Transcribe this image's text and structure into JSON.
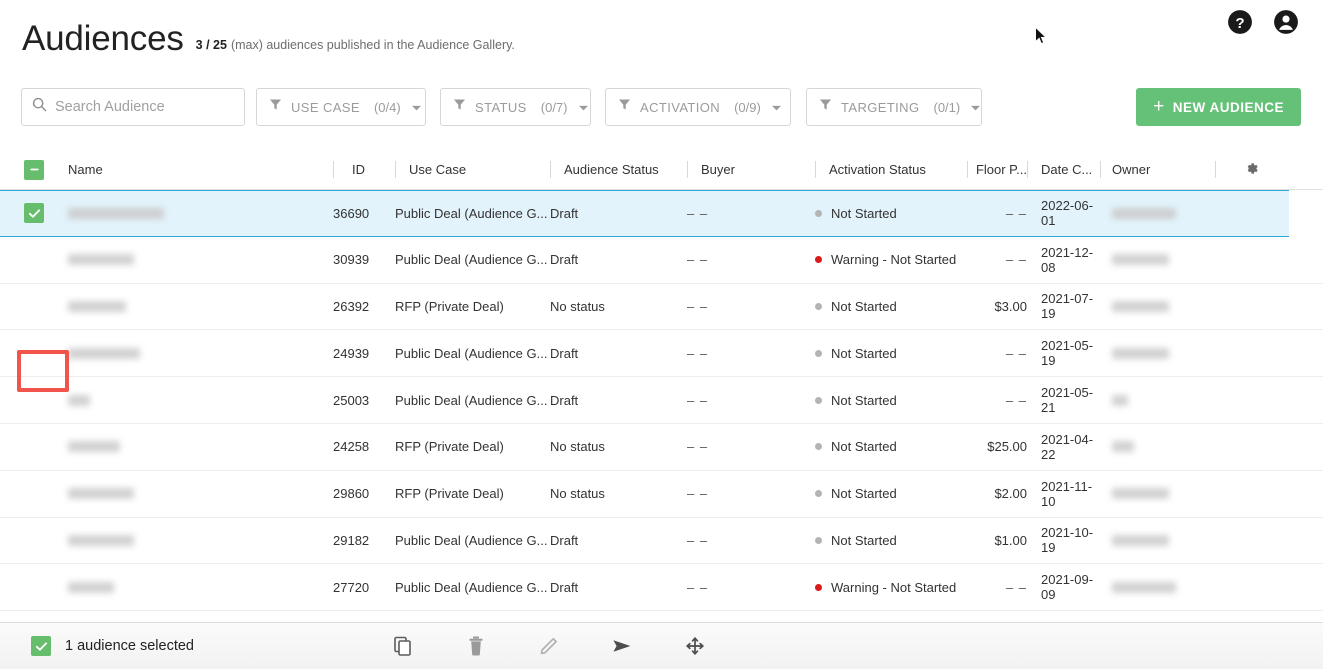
{
  "header": {
    "title": "Audiences",
    "count_current": "3",
    "count_sep": " / ",
    "count_max": "25",
    "subtitle_rest": "(max) audiences published in the Audience Gallery.",
    "help_icon": "help-circle-icon",
    "account_icon": "account-circle-icon"
  },
  "toolbar": {
    "search": {
      "placeholder": "Search Audience",
      "value": "",
      "icon": "search-icon"
    },
    "filters": [
      {
        "label": "USE CASE",
        "count": "(0/4)",
        "icon": "filter-funnel-icon"
      },
      {
        "label": "STATUS",
        "count": "(0/7)",
        "icon": "filter-funnel-icon"
      },
      {
        "label": "ACTIVATION",
        "count": "(0/9)",
        "icon": "filter-funnel-icon"
      },
      {
        "label": "TARGETING",
        "count": "(0/1)",
        "icon": "filter-funnel-icon"
      }
    ],
    "new_audience": {
      "label": "NEW AUDIENCE",
      "plus": "+",
      "color": "#65c178"
    }
  },
  "table": {
    "headers": {
      "name": "Name",
      "id": "ID",
      "use_case": "Use Case",
      "audience_status": "Audience Status",
      "buyer": "Buyer",
      "activation_status": "Activation Status",
      "floor_price": "Floor P...",
      "date_created": "Date C...",
      "owner": "Owner",
      "settings_icon": "gear-icon"
    },
    "select_all_state": "indeterminate",
    "rows": [
      {
        "selected": true,
        "name_redacted": true,
        "name_width": 96,
        "id": "36690",
        "use_case": "Public Deal (Audience G...",
        "audience_status": "Draft",
        "buyer": "– –",
        "activation_status": "Not Started",
        "activation_dot": "grey",
        "floor_price": "– –",
        "date_created": "2022-06-01",
        "owner_redacted": true,
        "owner_width": 64
      },
      {
        "selected": false,
        "name_redacted": true,
        "name_width": 66,
        "id": "30939",
        "use_case": "Public Deal (Audience G...",
        "audience_status": "Draft",
        "buyer": "– –",
        "activation_status": "Warning - Not Started",
        "activation_dot": "red",
        "floor_price": "– –",
        "date_created": "2021-12-08",
        "owner_redacted": true,
        "owner_width": 57
      },
      {
        "selected": false,
        "name_redacted": true,
        "name_width": 58,
        "id": "26392",
        "use_case": "RFP (Private Deal)",
        "audience_status": "No status",
        "buyer": "– –",
        "activation_status": "Not Started",
        "activation_dot": "grey",
        "floor_price": "$3.00",
        "date_created": "2021-07-19",
        "owner_redacted": true,
        "owner_width": 57
      },
      {
        "selected": false,
        "name_redacted": true,
        "name_width": 72,
        "id": "24939",
        "use_case": "Public Deal (Audience G...",
        "audience_status": "Draft",
        "buyer": "– –",
        "activation_status": "Not Started",
        "activation_dot": "grey",
        "floor_price": "– –",
        "date_created": "2021-05-19",
        "owner_redacted": true,
        "owner_width": 57
      },
      {
        "selected": false,
        "name_redacted": true,
        "name_width": 22,
        "id": "25003",
        "use_case": "Public Deal (Audience G...",
        "audience_status": "Draft",
        "buyer": "– –",
        "activation_status": "Not Started",
        "activation_dot": "grey",
        "floor_price": "– –",
        "date_created": "2021-05-21",
        "owner_redacted": true,
        "owner_width": 16
      },
      {
        "selected": false,
        "name_redacted": true,
        "name_width": 52,
        "id": "24258",
        "use_case": "RFP (Private Deal)",
        "audience_status": "No status",
        "buyer": "– –",
        "activation_status": "Not Started",
        "activation_dot": "grey",
        "floor_price": "$25.00",
        "date_created": "2021-04-22",
        "owner_redacted": true,
        "owner_width": 22
      },
      {
        "selected": false,
        "name_redacted": true,
        "name_width": 66,
        "id": "29860",
        "use_case": "RFP (Private Deal)",
        "audience_status": "No status",
        "buyer": "– –",
        "activation_status": "Not Started",
        "activation_dot": "grey",
        "floor_price": "$2.00",
        "date_created": "2021-11-10",
        "owner_redacted": true,
        "owner_width": 57
      },
      {
        "selected": false,
        "name_redacted": true,
        "name_width": 66,
        "id": "29182",
        "use_case": "Public Deal (Audience G...",
        "audience_status": "Draft",
        "buyer": "– –",
        "activation_status": "Not Started",
        "activation_dot": "grey",
        "floor_price": "$1.00",
        "date_created": "2021-10-19",
        "owner_redacted": true,
        "owner_width": 57
      },
      {
        "selected": false,
        "name_redacted": true,
        "name_width": 46,
        "id": "27720",
        "use_case": "Public Deal (Audience G...",
        "audience_status": "Draft",
        "buyer": "– –",
        "activation_status": "Warning - Not Started",
        "activation_dot": "red",
        "floor_price": "– –",
        "date_created": "2021-09-09",
        "owner_redacted": true,
        "owner_width": 64
      }
    ]
  },
  "bottom_bar": {
    "selection_text": "1 audience selected",
    "actions": [
      {
        "name": "copy-icon",
        "label": "Copy"
      },
      {
        "name": "delete-icon",
        "label": "Delete"
      },
      {
        "name": "edit-icon",
        "label": "Edit"
      },
      {
        "name": "send-icon",
        "label": "Send"
      },
      {
        "name": "move-icon",
        "label": "Move"
      }
    ]
  },
  "colors": {
    "accent_green": "#65c178",
    "selected_row_bg": "#e2f3fb",
    "selected_row_border": "#2ca8d6",
    "warning_dot": "#d81b1b",
    "neutral_dot": "#b4b4b4",
    "highlight_box": "#f0544a"
  }
}
